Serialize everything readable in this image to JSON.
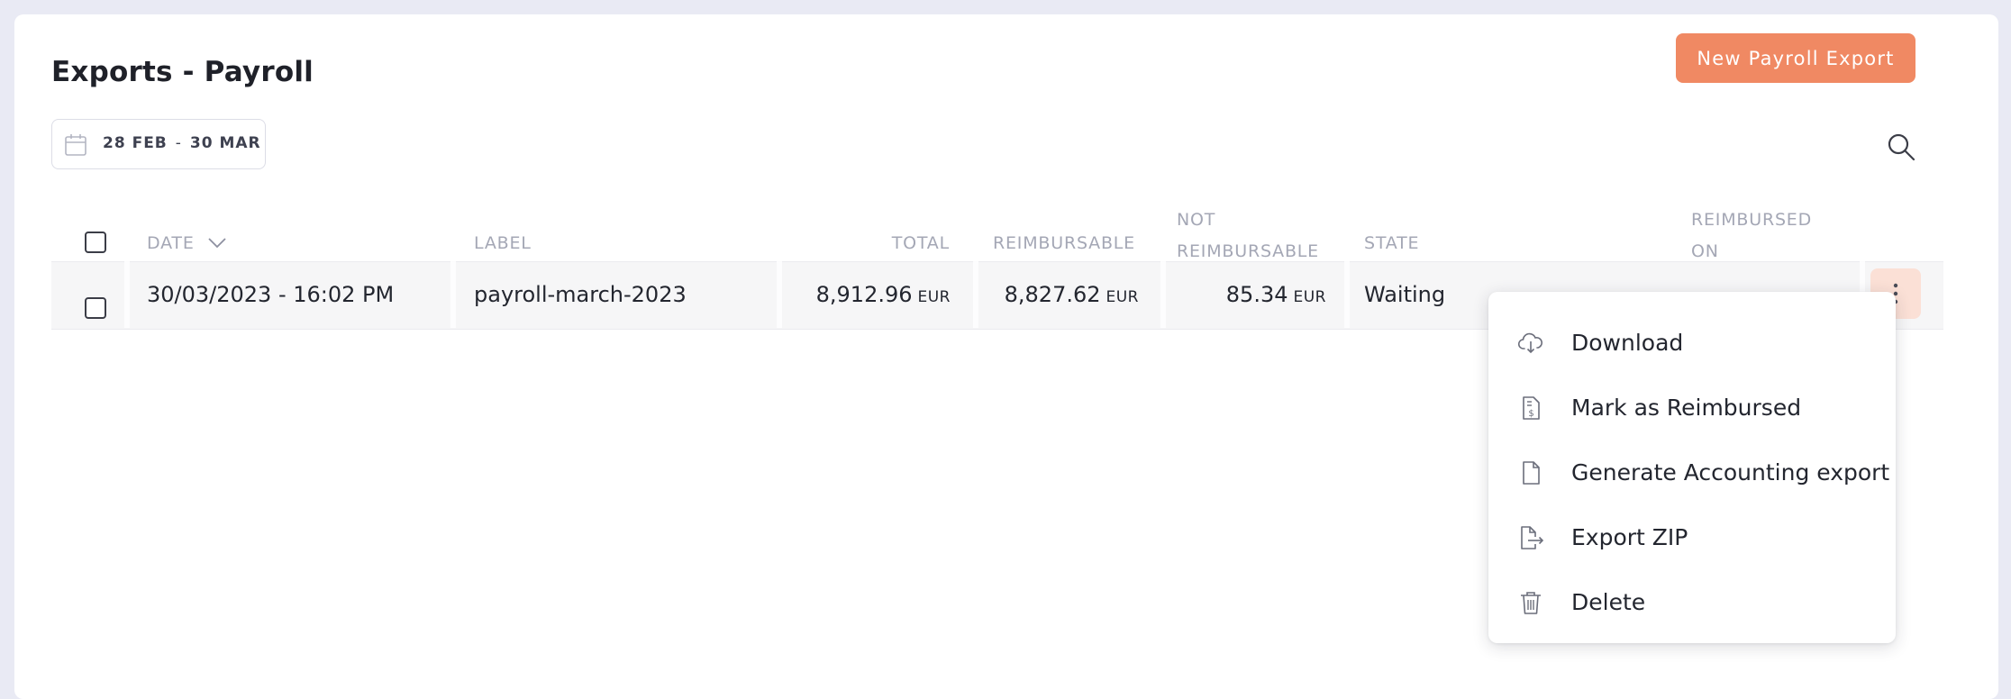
{
  "page": {
    "title": "Exports - Payroll"
  },
  "toolbar": {
    "new_export_label": "New Payroll Export",
    "date_range": {
      "start": "28 FEB",
      "separator": "-",
      "end": "30 MAR"
    }
  },
  "table": {
    "columns": {
      "date": "DATE",
      "label": "LABEL",
      "total": "TOTAL",
      "reimbursable": "REIMBURSABLE",
      "not_reimbursable_line1": "NOT",
      "not_reimbursable_line2": "REIMBURSABLE",
      "state": "STATE",
      "reimbursed_on_line1": "REIMBURSED",
      "reimbursed_on_line2": "ON"
    },
    "rows": [
      {
        "date": "30/03/2023 - 16:02 PM",
        "label": "payroll-march-2023",
        "total": "8,912.96",
        "reimbursable": "8,827.62",
        "not_reimbursable": "85.34",
        "currency": "EUR",
        "state": "Waiting",
        "reimbursed_on": ""
      }
    ]
  },
  "menu": {
    "items": [
      {
        "label": "Download",
        "icon": "cloud-download-icon"
      },
      {
        "label": "Mark as Reimbursed",
        "icon": "receipt-dollar-icon"
      },
      {
        "label": "Generate Accounting export",
        "icon": "file-icon"
      },
      {
        "label": "Export ZIP",
        "icon": "file-export-icon"
      },
      {
        "label": "Delete",
        "icon": "trash-icon"
      }
    ]
  },
  "colors": {
    "accent": "#f08963",
    "kebab_bg": "#fbe0d6",
    "page_bg": "#e9eaf4",
    "header_text": "#a4a7b5"
  }
}
